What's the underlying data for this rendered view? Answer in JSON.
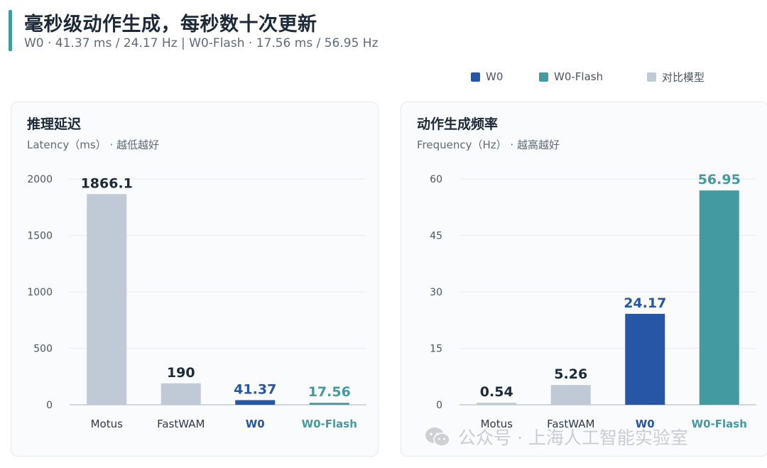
{
  "header": {
    "title": "毫秒级动作生成，每秒数十次更新",
    "subtitle": "W0 · 41.37 ms / 24.17 Hz  |  W0-Flash · 17.56 ms / 56.95 Hz"
  },
  "legend": [
    {
      "label": "W0",
      "color": "#2656a6"
    },
    {
      "label": "W0-Flash",
      "color": "#439aa1"
    },
    {
      "label": "对比模型",
      "color": "#c0c9d6"
    }
  ],
  "colors": {
    "compare": "#c0c9d6",
    "w0": "#2656a6",
    "w0_flash": "#439aa1",
    "label_dark": "#1c2a3a",
    "axis_text": "#4a5563"
  },
  "panels": {
    "latency": {
      "title": "推理延迟",
      "subtitle": "Latency（ms） · 越低越好"
    },
    "frequency": {
      "title": "动作生成频率",
      "subtitle": "Frequency（Hz） · 越高越好"
    }
  },
  "watermark": {
    "text": "公众号 · 上海人工智能实验室",
    "icon": "wechat-icon"
  },
  "chart_data": [
    {
      "type": "bar",
      "title": "推理延迟",
      "subtitle": "Latency（ms） · 越低越好",
      "categories": [
        "Motus",
        "FastWAM",
        "W0",
        "W0-Flash"
      ],
      "values": [
        1866.1,
        190,
        41.37,
        17.56
      ],
      "value_labels": [
        "1866.1",
        "190",
        "41.37",
        "17.56"
      ],
      "series_keys": [
        "compare",
        "compare",
        "w0",
        "w0_flash"
      ],
      "ylim": [
        0,
        2000
      ],
      "yticks": [
        0,
        500,
        1000,
        1500,
        2000
      ],
      "ytick_labels": [
        "0",
        "500",
        "1000",
        "1500",
        "2000"
      ],
      "grid": true,
      "legend_position": "top-right"
    },
    {
      "type": "bar",
      "title": "动作生成频率",
      "subtitle": "Frequency（Hz） · 越高越好",
      "categories": [
        "Motus",
        "FastWAM",
        "W0",
        "W0-Flash"
      ],
      "values": [
        0.54,
        5.26,
        24.17,
        56.95
      ],
      "value_labels": [
        "0.54",
        "5.26",
        "24.17",
        "56.95"
      ],
      "series_keys": [
        "compare",
        "compare",
        "w0",
        "w0_flash"
      ],
      "ylim": [
        0,
        60
      ],
      "yticks": [
        0,
        15,
        30,
        45,
        60
      ],
      "ytick_labels": [
        "0",
        "15",
        "30",
        "45",
        "60"
      ],
      "grid": true,
      "legend_position": "top-right"
    }
  ]
}
